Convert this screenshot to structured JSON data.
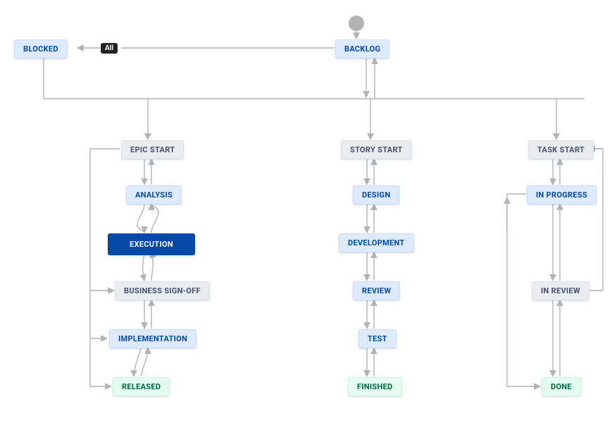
{
  "diagram": {
    "type": "workflow",
    "pill": {
      "label": "All"
    },
    "nodes": {
      "blocked": {
        "label": "BLOCKED",
        "style": "blue"
      },
      "backlog": {
        "label": "BACKLOG",
        "style": "blue"
      },
      "epic_start": {
        "label": "EPIC START",
        "style": "gray"
      },
      "story_start": {
        "label": "STORY START",
        "style": "gray"
      },
      "task_start": {
        "label": "TASK START",
        "style": "gray"
      },
      "analysis": {
        "label": "ANALYSIS",
        "style": "blue"
      },
      "execution": {
        "label": "EXECUTION",
        "style": "deep"
      },
      "business_signoff": {
        "label": "BUSINESS SIGN-OFF",
        "style": "gray"
      },
      "implementation": {
        "label": "IMPLEMENTATION",
        "style": "blue"
      },
      "released": {
        "label": "RELEASED",
        "style": "green"
      },
      "design": {
        "label": "DESIGN",
        "style": "blue"
      },
      "development": {
        "label": "DEVELOPMENT",
        "style": "blue"
      },
      "review": {
        "label": "REVIEW",
        "style": "blue"
      },
      "test": {
        "label": "TEST",
        "style": "blue"
      },
      "finished": {
        "label": "FINISHED",
        "style": "green"
      },
      "in_progress": {
        "label": "IN PROGRESS",
        "style": "blue"
      },
      "in_review": {
        "label": "IN REVIEW",
        "style": "gray"
      },
      "done": {
        "label": "DONE",
        "style": "green"
      }
    },
    "edges": [
      [
        "start_circle",
        "backlog",
        "down"
      ],
      [
        "backlog",
        "blocked",
        "left-with-pill"
      ],
      [
        "blocked",
        "backlog-row",
        "down-right"
      ],
      [
        "backlog",
        "epic_start",
        "down"
      ],
      [
        "backlog",
        "story_start",
        "down"
      ],
      [
        "backlog",
        "task_start",
        "down"
      ],
      [
        "epic_start",
        "analysis",
        "bidir"
      ],
      [
        "analysis",
        "execution",
        "bidir"
      ],
      [
        "execution",
        "business_signoff",
        "bidir"
      ],
      [
        "business_signoff",
        "implementation",
        "bidir"
      ],
      [
        "implementation",
        "released",
        "bidir"
      ],
      [
        "epic_start",
        "released",
        "loop-left"
      ],
      [
        "story_start",
        "design",
        "bidir"
      ],
      [
        "design",
        "development",
        "bidir"
      ],
      [
        "development",
        "review",
        "bidir"
      ],
      [
        "review",
        "test",
        "bidir"
      ],
      [
        "test",
        "finished",
        "bidir"
      ],
      [
        "task_start",
        "in_progress",
        "bidir"
      ],
      [
        "in_progress",
        "in_review",
        "bidir"
      ],
      [
        "in_review",
        "done",
        "bidir"
      ],
      [
        "task_start",
        "done",
        "loop-right"
      ],
      [
        "task_start",
        "in_review",
        "loop-right-outer"
      ]
    ]
  }
}
